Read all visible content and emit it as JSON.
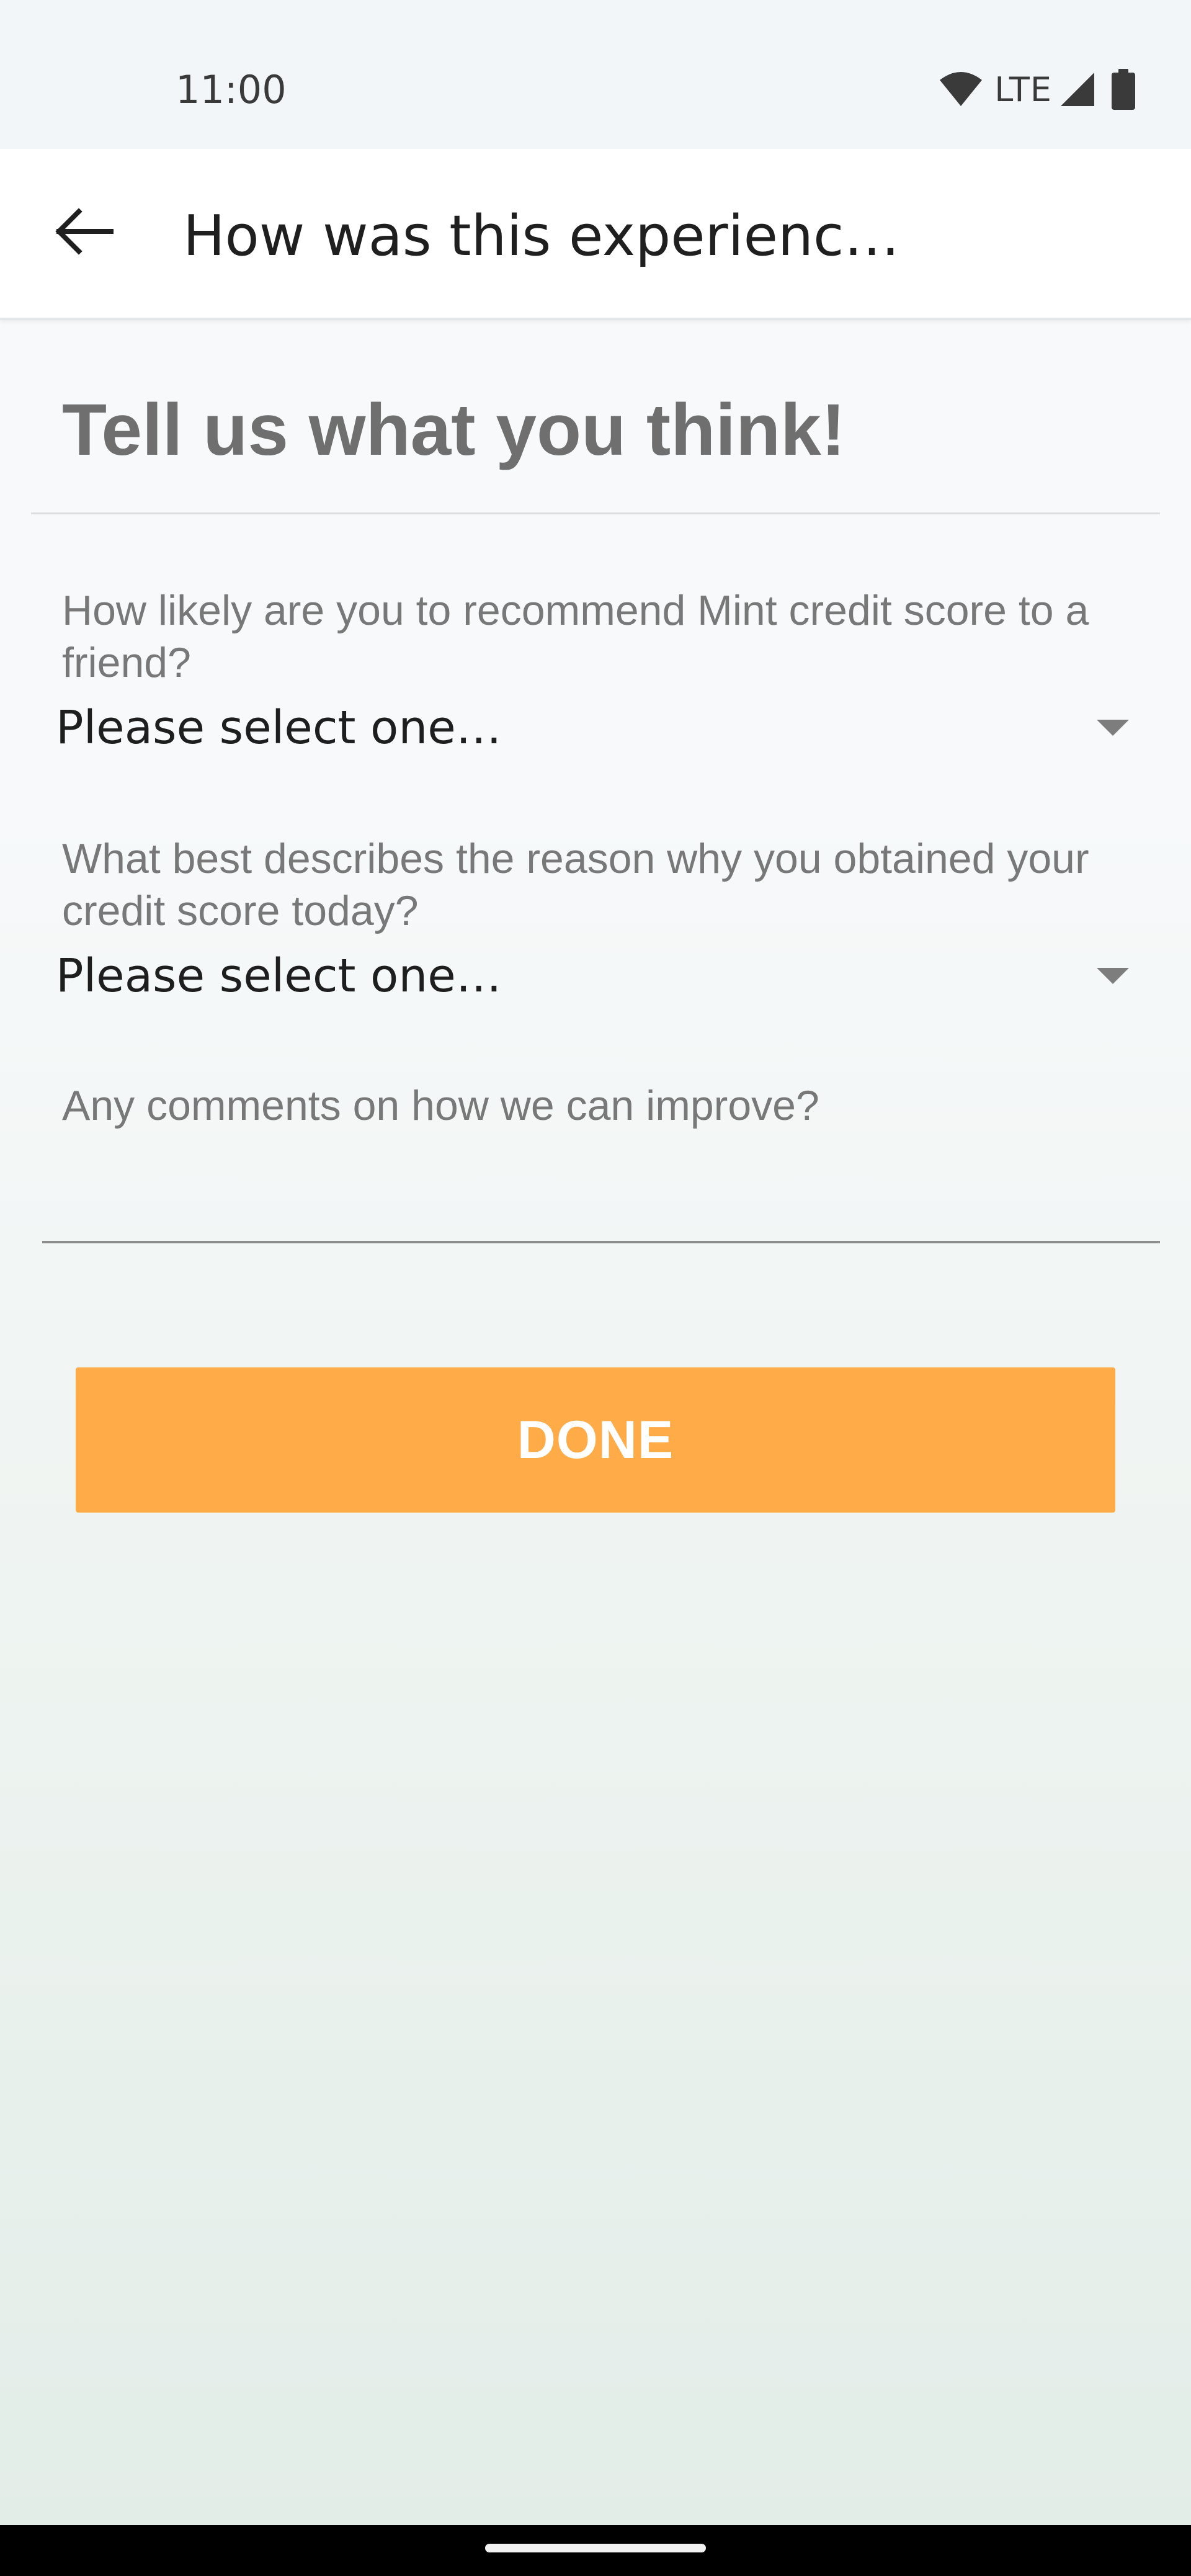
{
  "status_bar": {
    "time": "11:00",
    "network": "LTE",
    "icons": [
      "wifi-icon",
      "cell-signal-icon",
      "battery-icon"
    ]
  },
  "app_bar": {
    "title": "How was this experienc…",
    "back_icon": "arrow-left-icon"
  },
  "form": {
    "heading": "Tell us what you think!",
    "questions": [
      {
        "label": "How likely are you to recommend Mint credit score to a friend?",
        "selected": "Please select one…"
      },
      {
        "label": "What best describes the reason why you obtained your credit score today?",
        "selected": "Please select one…"
      }
    ],
    "comments": {
      "label": "Any comments on how we can improve?",
      "value": ""
    },
    "done_label": "DONE"
  },
  "colors": {
    "accent": "#ffab48",
    "heading": "#6f6f6f",
    "label": "#787878",
    "text": "#1e1e1e"
  }
}
